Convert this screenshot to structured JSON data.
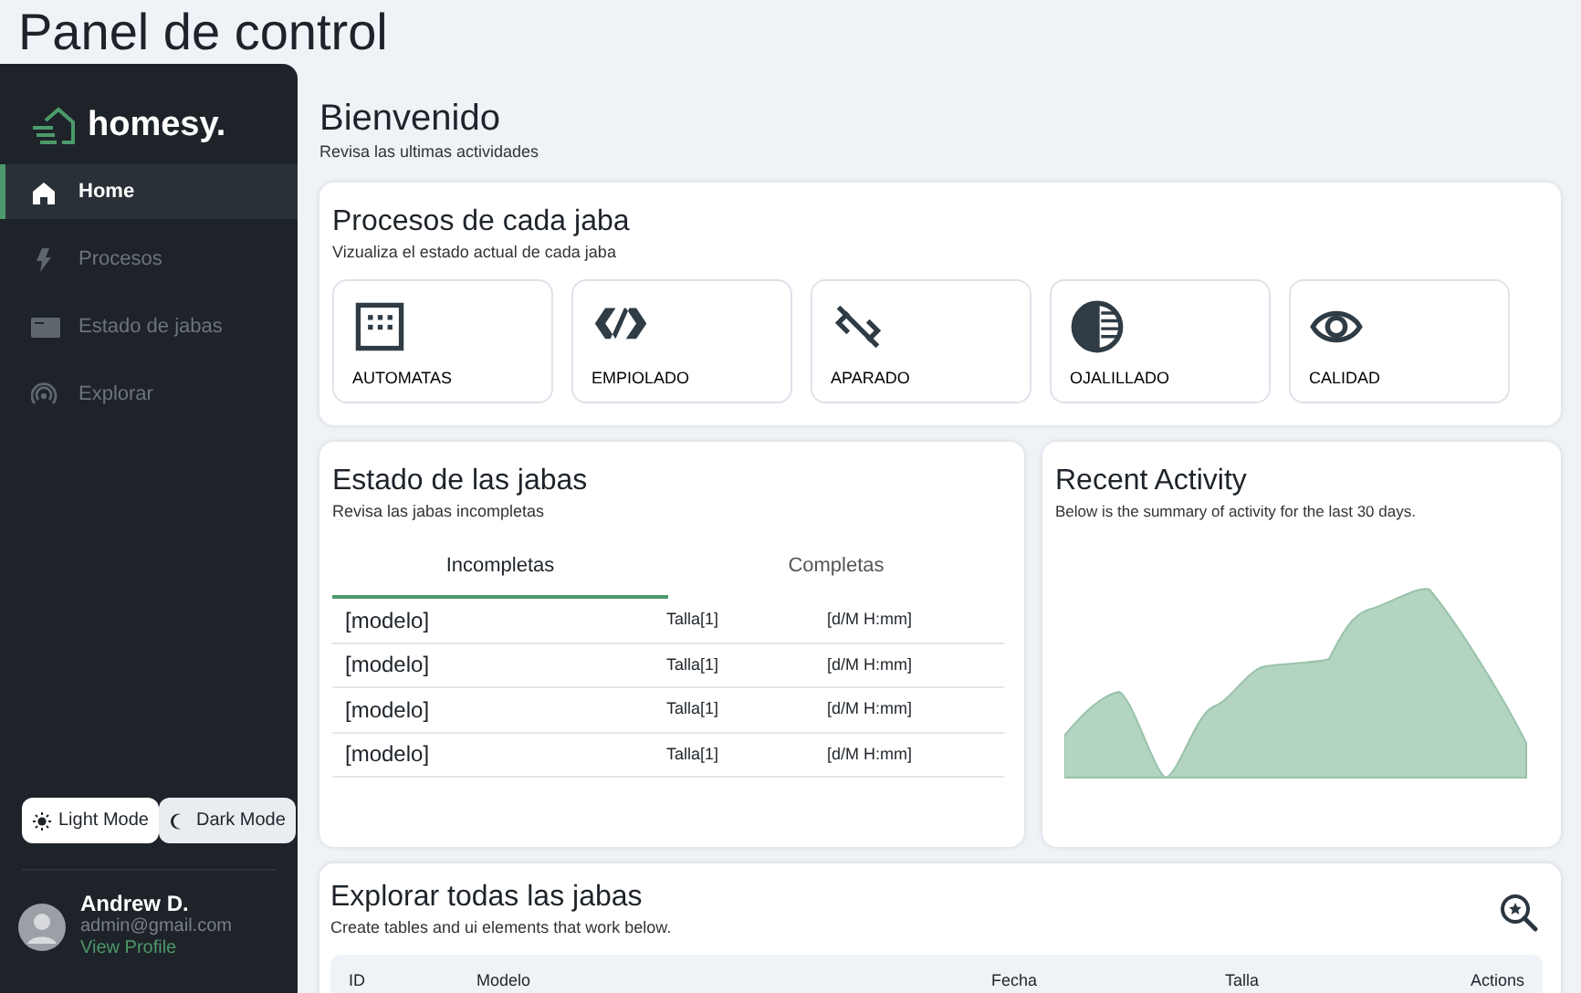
{
  "page_title": "Panel de control",
  "sidebar": {
    "brand": "homesy.",
    "items": [
      {
        "label": "Home",
        "selected": true
      },
      {
        "label": "Procesos",
        "selected": false
      },
      {
        "label": "Estado de jabas",
        "selected": false
      },
      {
        "label": "Explorar",
        "selected": false
      }
    ],
    "modes": [
      {
        "label": "Light Mode",
        "selected": true
      },
      {
        "label": "Dark Mode",
        "selected": false
      }
    ],
    "user": {
      "name": "Andrew D.",
      "email": "admin@gmail.com",
      "link": "View Profile"
    }
  },
  "header": {
    "title": "Bienvenido",
    "subtitle": "Revisa las ultimas actividades"
  },
  "processes": {
    "title": "Procesos de cada jaba",
    "subtitle": "Vizualiza el estado actual de cada jaba",
    "items": [
      {
        "label": "AUTOMATAS"
      },
      {
        "label": "EMPIOLADO"
      },
      {
        "label": "APARADO"
      },
      {
        "label": "OJALILLADO"
      },
      {
        "label": "CALIDAD"
      }
    ]
  },
  "status": {
    "title": "Estado de las jabas",
    "subtitle": "Revisa las jabas incompletas",
    "tabs": [
      {
        "label": "Incompletas",
        "selected": true
      },
      {
        "label": "Completas",
        "selected": false
      }
    ],
    "rows": [
      {
        "model": "[modelo]",
        "size": "Talla[1]",
        "date": "[d/M H:mm]"
      },
      {
        "model": "[modelo]",
        "size": "Talla[1]",
        "date": "[d/M H:mm]"
      },
      {
        "model": "[modelo]",
        "size": "Talla[1]",
        "date": "[d/M H:mm]"
      },
      {
        "model": "[modelo]",
        "size": "Talla[1]",
        "date": "[d/M H:mm]"
      }
    ]
  },
  "activity": {
    "title": "Recent Activity",
    "subtitle": "Below is the summary of activity for the last 30 days."
  },
  "explore": {
    "title": "Explorar todas las jabas",
    "subtitle": "Create tables and ui elements that work below.",
    "columns": [
      "ID",
      "Modelo",
      "Fecha",
      "Talla",
      "Actions"
    ]
  }
}
